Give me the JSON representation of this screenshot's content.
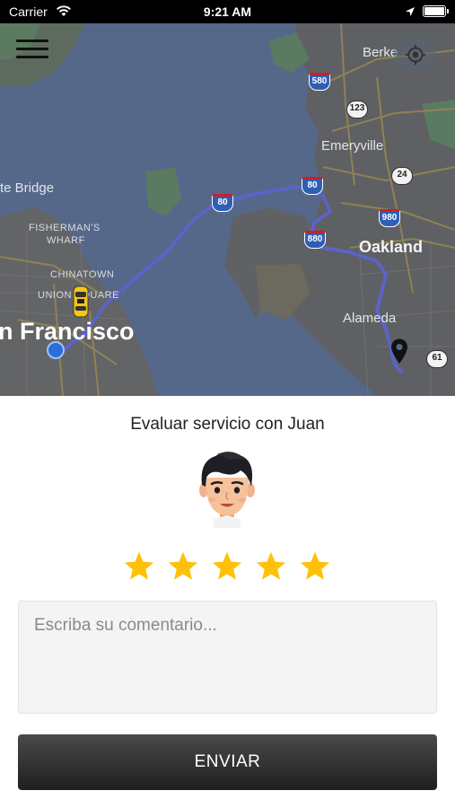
{
  "status_bar": {
    "carrier": "Carrier",
    "time": "9:21 AM",
    "icons": [
      "wifi-icon",
      "location-arrow-icon",
      "battery-icon"
    ]
  },
  "map": {
    "labels": {
      "berkeley": "Berke",
      "emeryville": "Emeryville",
      "golden_gate": "te Bridge",
      "fishermans_wharf_1": "FISHERMAN'S",
      "fishermans_wharf_2": "WHARF",
      "chinatown": "CHINATOWN",
      "union_square": "UNION SQUARE",
      "oakland": "Oakland",
      "alameda": "Alameda",
      "san_francisco": "n Francisco"
    },
    "shields": {
      "i580": "580",
      "r123": "123",
      "i80_east": "80",
      "i80_bay": "80",
      "r24": "24",
      "i980": "980",
      "i880": "880",
      "r61": "61"
    },
    "icons": [
      "menu-icon",
      "locate-icon",
      "taxi-icon",
      "origin-dot",
      "destination-pin-icon"
    ],
    "colors": {
      "water": "#55688a",
      "land": "#5f6063",
      "route": "#5a63c8"
    }
  },
  "rating": {
    "title": "Evaluar servicio con Juan",
    "driver_avatar": "driver-avatar",
    "stars": 5,
    "max_stars": 5,
    "star_color": "#ffc107",
    "comment_placeholder": "Escriba su comentario...",
    "comment_value": "",
    "submit_label": "ENVIAR"
  }
}
